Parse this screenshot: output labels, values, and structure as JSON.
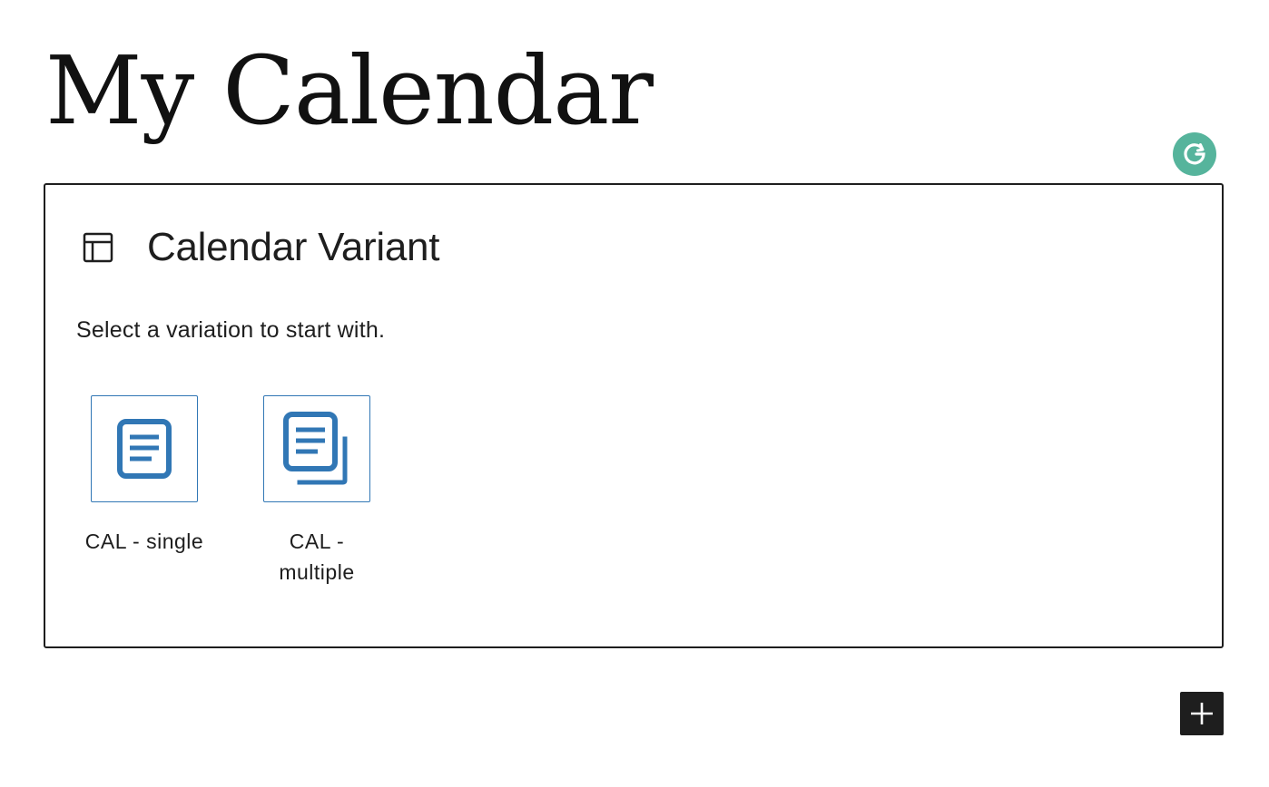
{
  "page": {
    "title": "My Calendar"
  },
  "block": {
    "title": "Calendar Variant",
    "icon": "layout-icon",
    "instructions": "Select a variation to start with.",
    "variations": [
      {
        "label": "CAL - single",
        "icon": "page-icon"
      },
      {
        "label": "CAL - multiple",
        "icon": "pages-icon"
      }
    ]
  },
  "toolbar": {
    "add_block_icon": "plus-icon",
    "grammarly_icon": "grammarly-icon"
  },
  "colors": {
    "accent": "#3177b5",
    "grammarly": "#56b49c",
    "text": "#1e1e1e",
    "border": "#1e1e1e"
  }
}
